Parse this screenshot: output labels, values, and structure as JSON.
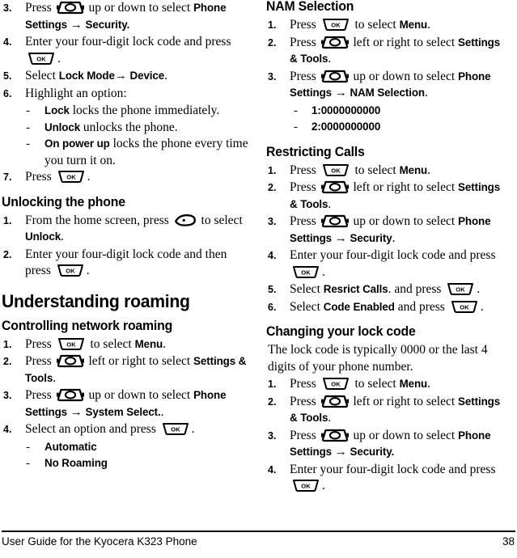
{
  "document": {
    "footer_title": "User Guide for the Kyocera K323 Phone",
    "page_number": "38"
  },
  "icons": {
    "nav_key": "navigation-key-icon",
    "ok_key": "ok-key-icon",
    "ok_label": "OK",
    "softkey": "left-softkey-icon"
  },
  "left_column": {
    "continued_steps": [
      {
        "num": "3.",
        "parts": [
          {
            "t": "text",
            "v": "Press "
          },
          {
            "t": "key",
            "v": "nav"
          },
          {
            "t": "text",
            "v": " up or down to select "
          },
          {
            "t": "bold",
            "v": "Phone Settings"
          },
          {
            "t": "arrow",
            "v": " → "
          },
          {
            "t": "bold",
            "v": "Security."
          }
        ]
      },
      {
        "num": "4.",
        "parts": [
          {
            "t": "text",
            "v": "Enter your four-digit lock code and press "
          },
          {
            "t": "key",
            "v": "ok"
          },
          {
            "t": "text",
            "v": "."
          }
        ]
      },
      {
        "num": "5.",
        "parts": [
          {
            "t": "text",
            "v": "Select "
          },
          {
            "t": "bold",
            "v": "Lock Mode"
          },
          {
            "t": "arrow",
            "v": "→ "
          },
          {
            "t": "bold",
            "v": "Device"
          },
          {
            "t": "text",
            "v": "."
          }
        ]
      },
      {
        "num": "6.",
        "parts": [
          {
            "t": "text",
            "v": "Highlight an option:"
          }
        ]
      }
    ],
    "option_bullets": [
      {
        "bold": "Lock",
        "rest": " locks the phone immediately."
      },
      {
        "bold": "Unlock",
        "rest": " unlocks the phone."
      },
      {
        "bold": "On power up",
        "rest": " locks the phone every time you turn it on."
      }
    ],
    "step7": {
      "num": "7.",
      "parts": [
        {
          "t": "text",
          "v": "Press "
        },
        {
          "t": "key",
          "v": "ok"
        },
        {
          "t": "text",
          "v": "."
        }
      ]
    },
    "unlocking_heading": "Unlocking the phone",
    "unlocking_steps": [
      {
        "num": "1.",
        "parts": [
          {
            "t": "text",
            "v": "From the home screen, press "
          },
          {
            "t": "key",
            "v": "soft"
          },
          {
            "t": "text",
            "v": " to select "
          },
          {
            "t": "bold",
            "v": "Unlock"
          },
          {
            "t": "text",
            "v": "."
          }
        ]
      },
      {
        "num": "2.",
        "parts": [
          {
            "t": "text",
            "v": "Enter your four-digit lock code and then press "
          },
          {
            "t": "key",
            "v": "ok"
          },
          {
            "t": "text",
            "v": "."
          }
        ]
      }
    ],
    "roaming_heading": "Understanding roaming",
    "controlling_heading": "Controlling network roaming",
    "controlling_steps": [
      {
        "num": "1.",
        "parts": [
          {
            "t": "text",
            "v": "Press "
          },
          {
            "t": "key",
            "v": "ok"
          },
          {
            "t": "text",
            "v": " to select "
          },
          {
            "t": "bold",
            "v": "Menu"
          },
          {
            "t": "text",
            "v": "."
          }
        ]
      },
      {
        "num": "2.",
        "parts": [
          {
            "t": "text",
            "v": "Press "
          },
          {
            "t": "key",
            "v": "nav"
          },
          {
            "t": "text",
            "v": " left or right to select "
          },
          {
            "t": "bold",
            "v": "Settings & Tools"
          },
          {
            "t": "text",
            "v": "."
          }
        ]
      },
      {
        "num": "3.",
        "parts": [
          {
            "t": "text",
            "v": "Press "
          },
          {
            "t": "key",
            "v": "nav"
          },
          {
            "t": "text",
            "v": " up or down to select "
          },
          {
            "t": "bold",
            "v": "Phone Settings"
          },
          {
            "t": "arrow",
            "v": " → "
          },
          {
            "t": "bold",
            "v": "System Select."
          },
          {
            "t": "text",
            "v": "."
          }
        ]
      },
      {
        "num": "4.",
        "parts": [
          {
            "t": "text",
            "v": "Select an option and press "
          },
          {
            "t": "key",
            "v": "ok"
          },
          {
            "t": "text",
            "v": "."
          }
        ]
      }
    ],
    "roaming_options": [
      {
        "bold": "Automatic",
        "rest": ""
      },
      {
        "bold": "No Roaming",
        "rest": ""
      }
    ]
  },
  "right_column": {
    "nam_heading": "NAM Selection",
    "nam_steps": [
      {
        "num": "1.",
        "parts": [
          {
            "t": "text",
            "v": "Press "
          },
          {
            "t": "key",
            "v": "ok"
          },
          {
            "t": "text",
            "v": " to select "
          },
          {
            "t": "bold",
            "v": "Menu"
          },
          {
            "t": "text",
            "v": "."
          }
        ]
      },
      {
        "num": "2.",
        "parts": [
          {
            "t": "text",
            "v": "Press "
          },
          {
            "t": "key",
            "v": "nav"
          },
          {
            "t": "text",
            "v": " left or right to select "
          },
          {
            "t": "bold",
            "v": "Settings & Tools"
          },
          {
            "t": "text",
            "v": "."
          }
        ]
      },
      {
        "num": "3.",
        "parts": [
          {
            "t": "text",
            "v": "Press "
          },
          {
            "t": "key",
            "v": "nav"
          },
          {
            "t": "text",
            "v": " up or down to select "
          },
          {
            "t": "bold",
            "v": "Phone Settings"
          },
          {
            "t": "arrow",
            "v": " → "
          },
          {
            "t": "bold",
            "v": "NAM Selection"
          },
          {
            "t": "text",
            "v": "."
          }
        ]
      }
    ],
    "nam_options": [
      {
        "bold": "1:0000000000",
        "rest": ""
      },
      {
        "bold": "2:0000000000",
        "rest": ""
      }
    ],
    "restricting_heading": "Restricting Calls",
    "restricting_steps": [
      {
        "num": "1.",
        "parts": [
          {
            "t": "text",
            "v": "Press "
          },
          {
            "t": "key",
            "v": "ok"
          },
          {
            "t": "text",
            "v": " to select "
          },
          {
            "t": "bold",
            "v": "Menu"
          },
          {
            "t": "text",
            "v": "."
          }
        ]
      },
      {
        "num": "2.",
        "parts": [
          {
            "t": "text",
            "v": "Press "
          },
          {
            "t": "key",
            "v": "nav"
          },
          {
            "t": "text",
            "v": " left or right to select "
          },
          {
            "t": "bold",
            "v": "Settings & Tools"
          },
          {
            "t": "text",
            "v": "."
          }
        ]
      },
      {
        "num": "3.",
        "parts": [
          {
            "t": "text",
            "v": "Press "
          },
          {
            "t": "key",
            "v": "nav"
          },
          {
            "t": "text",
            "v": " up or down to select "
          },
          {
            "t": "bold",
            "v": "Phone Settings"
          },
          {
            "t": "arrow",
            "v": " → "
          },
          {
            "t": "bold",
            "v": "Security"
          },
          {
            "t": "text",
            "v": "."
          }
        ]
      },
      {
        "num": "4.",
        "parts": [
          {
            "t": "text",
            "v": "Enter your four-digit lock code and press "
          },
          {
            "t": "key",
            "v": "ok"
          },
          {
            "t": "text",
            "v": "."
          }
        ]
      },
      {
        "num": "5.",
        "parts": [
          {
            "t": "text",
            "v": "Select "
          },
          {
            "t": "bold",
            "v": "Resrict Calls"
          },
          {
            "t": "text",
            "v": ". and press "
          },
          {
            "t": "key",
            "v": "ok"
          },
          {
            "t": "text",
            "v": "."
          }
        ]
      },
      {
        "num": "6.",
        "parts": [
          {
            "t": "text",
            "v": "Select "
          },
          {
            "t": "bold",
            "v": "Code Enabled"
          },
          {
            "t": "text",
            "v": " and press "
          },
          {
            "t": "key",
            "v": "ok"
          },
          {
            "t": "text",
            "v": "."
          }
        ]
      }
    ],
    "changing_heading": "Changing your lock code",
    "changing_intro": "The lock code is typically 0000 or the last 4 digits of your phone number.",
    "changing_steps": [
      {
        "num": "1.",
        "parts": [
          {
            "t": "text",
            "v": "Press "
          },
          {
            "t": "key",
            "v": "ok"
          },
          {
            "t": "text",
            "v": " to select "
          },
          {
            "t": "bold",
            "v": "Menu"
          },
          {
            "t": "text",
            "v": "."
          }
        ]
      },
      {
        "num": "2.",
        "parts": [
          {
            "t": "text",
            "v": "Press "
          },
          {
            "t": "key",
            "v": "nav"
          },
          {
            "t": "text",
            "v": " left or right to select "
          },
          {
            "t": "bold",
            "v": "Settings & Tools"
          },
          {
            "t": "text",
            "v": "."
          }
        ]
      },
      {
        "num": "3.",
        "parts": [
          {
            "t": "text",
            "v": "Press "
          },
          {
            "t": "key",
            "v": "nav"
          },
          {
            "t": "text",
            "v": " up or down to select "
          },
          {
            "t": "bold",
            "v": "Phone Settings"
          },
          {
            "t": "arrow",
            "v": " → "
          },
          {
            "t": "bold",
            "v": "Security."
          }
        ]
      },
      {
        "num": "4.",
        "parts": [
          {
            "t": "text",
            "v": "Enter your four-digit lock code and press "
          },
          {
            "t": "key",
            "v": "ok"
          },
          {
            "t": "text",
            "v": "."
          }
        ]
      }
    ]
  }
}
